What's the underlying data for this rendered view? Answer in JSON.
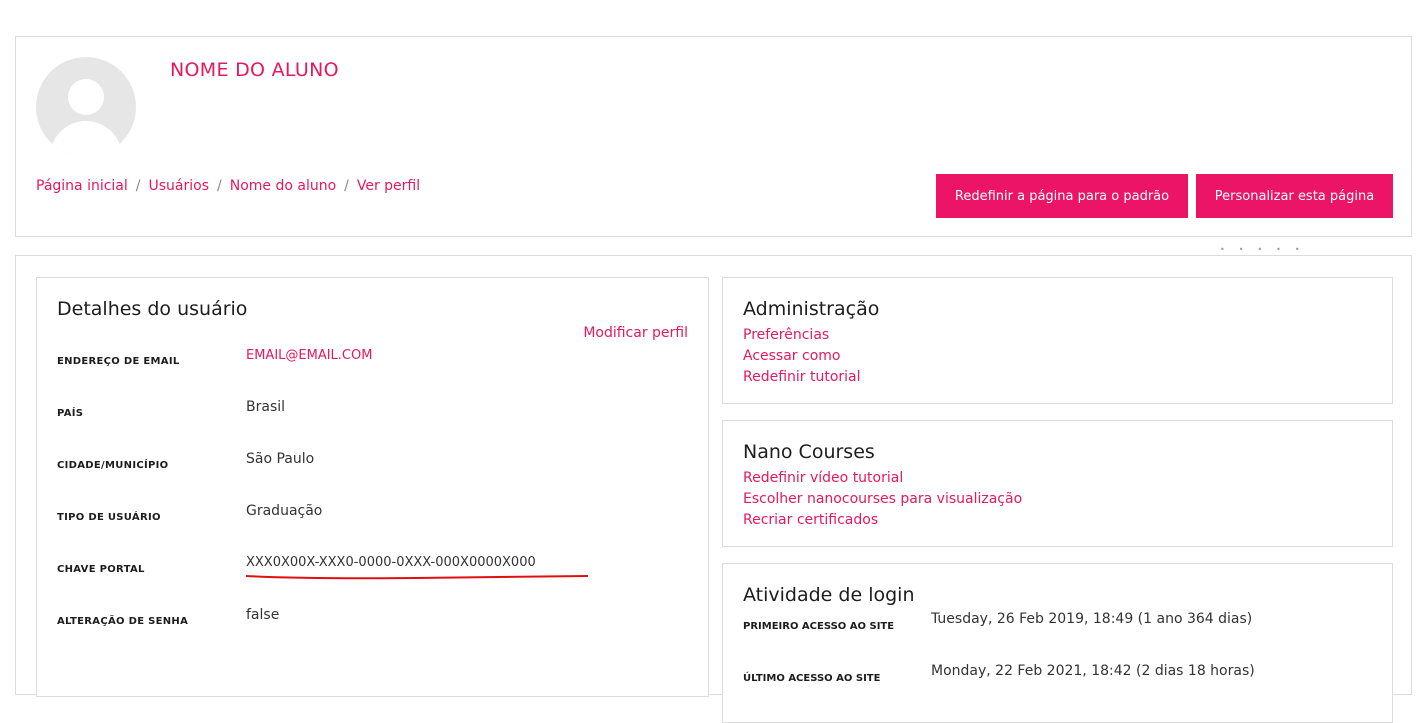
{
  "header": {
    "profile_name": "NOME DO ALUNO",
    "breadcrumb": [
      "Página inicial",
      "Usuários",
      "Nome do aluno",
      "Ver perfil"
    ],
    "buttons": {
      "reset": "Redefinir a página para o padrão",
      "customize": "Personalizar esta página"
    }
  },
  "user_details": {
    "title": "Detalhes do usuário",
    "edit_link": "Modificar perfil",
    "fields": [
      {
        "label": "ENDEREÇO DE EMAIL",
        "value": "EMAIL@EMAIL.COM"
      },
      {
        "label": "PAÍS",
        "value": "Brasil"
      },
      {
        "label": "CIDADE/MUNICÍPIO",
        "value": "São Paulo"
      },
      {
        "label": "TIPO DE USUÁRIO",
        "value": "Graduação"
      },
      {
        "label": "CHAVE PORTAL",
        "value": "XXX0X00X-XXX0-0000-0XXX-000X0000X000"
      },
      {
        "label": "ALTERAÇÃO DE SENHA",
        "value": "false"
      }
    ]
  },
  "administration": {
    "title": "Administração",
    "links": [
      "Preferências",
      "Acessar como",
      "Redefinir tutorial"
    ]
  },
  "nano_courses": {
    "title": "Nano Courses",
    "links": [
      "Redefinir vídeo tutorial",
      "Escolher nanocourses para visualização",
      "Recriar certificados"
    ]
  },
  "login_activity": {
    "title": "Atividade de login",
    "rows": [
      {
        "label": "PRIMEIRO ACESSO AO SITE",
        "value": "Tuesday, 26 Feb 2019, 18:49  (1 ano 364 dias)"
      },
      {
        "label": "ÚLTIMO ACESSO AO SITE",
        "value": "Monday, 22 Feb 2021, 18:42  (2 dias 18 horas)"
      }
    ]
  },
  "colors": {
    "accent": "#e5195c",
    "button": "#eb1466",
    "annotation": "#e01010"
  },
  "icons": {
    "avatar": "default-user-avatar-icon"
  }
}
